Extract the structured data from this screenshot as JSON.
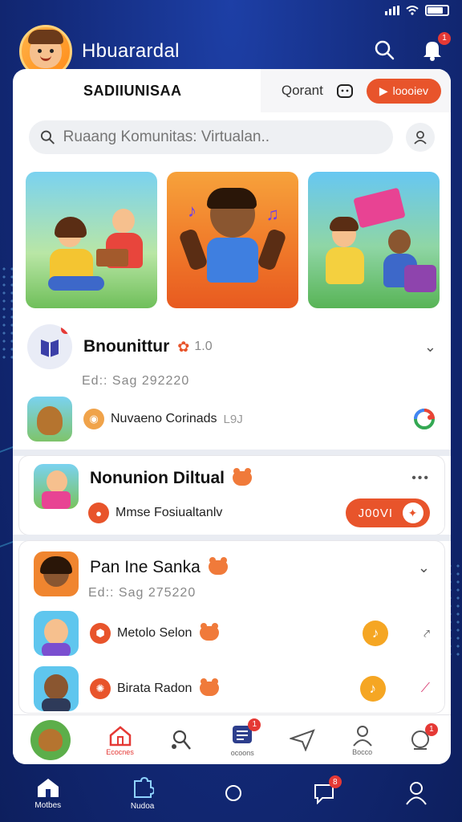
{
  "status": {
    "signal": "signal-icon",
    "wifi": "wifi-icon",
    "battery_level": 0.8
  },
  "header": {
    "title": "Hbuarardal",
    "notif_count": "1"
  },
  "card": {
    "section_title": "SADIIUNISAA",
    "grant_label": "Qorant",
    "action_label": "loooiev"
  },
  "search": {
    "placeholder": "Ruaang Komunitas: Virtualan.."
  },
  "community": {
    "name": "Bnounittur",
    "rating": "1.0",
    "date": "Ed:: Sag 292220",
    "item_label": "Nuvaeno Corinads",
    "item_meta": "L9J"
  },
  "virtual": {
    "name": "Nonunion Diltual",
    "item_label": "Mmse Fosiualtanlv",
    "join_label": "J00VI"
  },
  "pane": {
    "name": "Pan Ine Sanka",
    "date": "Ed:: Sag 275220",
    "items": [
      {
        "label": "Metolo Selon"
      },
      {
        "label": "Birata Radon"
      }
    ]
  },
  "card_tabs": [
    {
      "label": "Ecocnes",
      "icon": "house-tree-icon"
    },
    {
      "label": "",
      "icon": "people-search-icon"
    },
    {
      "label": "ocoons",
      "icon": "chat-doc-icon",
      "badge": "1"
    },
    {
      "label": "",
      "icon": "send-icon"
    },
    {
      "label": "Bocco",
      "icon": "person-icon"
    },
    {
      "label": "",
      "icon": "globe-alert-icon",
      "badge": "1"
    }
  ],
  "bottom_nav": [
    {
      "label": "Motbes",
      "icon": "home-icon"
    },
    {
      "label": "Nudoa",
      "icon": "puzzle-icon"
    },
    {
      "label": "",
      "icon": "circle-icon"
    },
    {
      "label": "",
      "icon": "message-icon",
      "badge": "8"
    },
    {
      "label": "",
      "icon": "user-icon"
    }
  ],
  "colors": {
    "accent": "#e8542b",
    "background": "#132a7a",
    "music": "#f5a623"
  }
}
